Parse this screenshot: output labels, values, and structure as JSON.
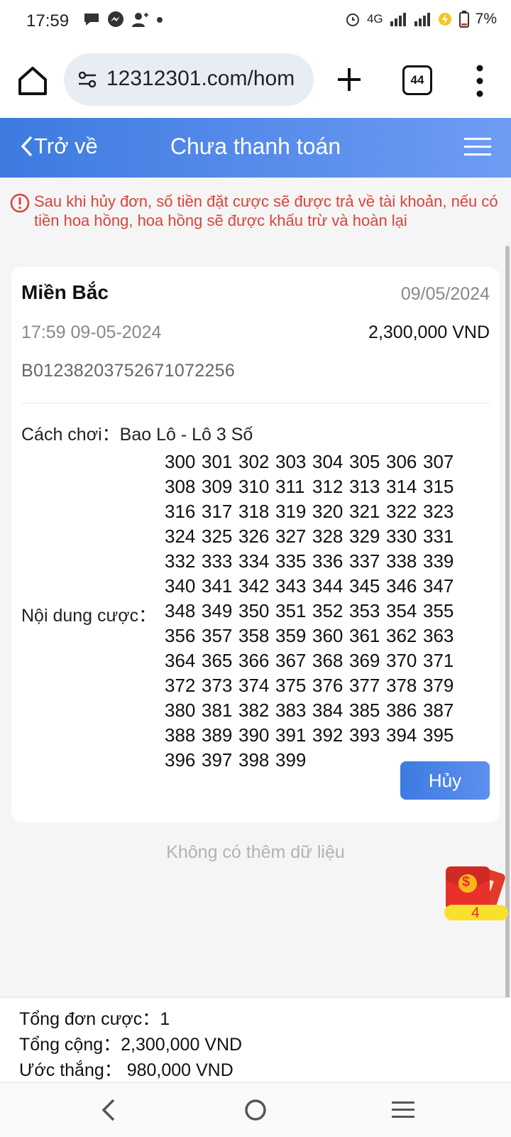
{
  "status": {
    "time": "17:59",
    "network": "4G",
    "battery": "7%"
  },
  "browser": {
    "url": "12312301.com/hom",
    "tab_count": "44"
  },
  "header": {
    "back_label": "Trở về",
    "title": "Chưa thanh toán"
  },
  "notice": {
    "text": "Sau khi hủy đơn, số tiền đặt cược sẽ được trả về tài khoản, nếu có tiền hoa hồng, hoa hồng sẽ được khấu trừ và hoàn lại"
  },
  "order": {
    "region": "Miền Bắc",
    "date": "09/05/2024",
    "time": "17:59 09-05-2024",
    "amount": "2,300,000 VND",
    "code": "B01238203752671072256",
    "play_type_label": "Cách chơi：",
    "play_type": "Bao Lô - Lô 3 Số",
    "bet_label": "Nội dung cược：",
    "numbers": [
      [
        "300",
        "301",
        "302",
        "303",
        "304",
        "305",
        "306",
        "307"
      ],
      [
        "308",
        "309",
        "310",
        "311",
        "312",
        "313",
        "314",
        "315"
      ],
      [
        "316",
        "317",
        "318",
        "319",
        "320",
        "321",
        "322",
        "323"
      ],
      [
        "324",
        "325",
        "326",
        "327",
        "328",
        "329",
        "330",
        "331"
      ],
      [
        "332",
        "333",
        "334",
        "335",
        "336",
        "337",
        "338",
        "339"
      ],
      [
        "340",
        "341",
        "342",
        "343",
        "344",
        "345",
        "346",
        "347"
      ],
      [
        "348",
        "349",
        "350",
        "351",
        "352",
        "353",
        "354",
        "355"
      ],
      [
        "356",
        "357",
        "358",
        "359",
        "360",
        "361",
        "362",
        "363"
      ],
      [
        "364",
        "365",
        "366",
        "367",
        "368",
        "369",
        "370",
        "371"
      ],
      [
        "372",
        "373",
        "374",
        "375",
        "376",
        "377",
        "378",
        "379"
      ],
      [
        "380",
        "381",
        "382",
        "383",
        "384",
        "385",
        "386",
        "387"
      ],
      [
        "388",
        "389",
        "390",
        "391",
        "392",
        "393",
        "394",
        "395"
      ],
      [
        "396",
        "397",
        "398",
        "399"
      ]
    ],
    "cancel_label": "Hủy"
  },
  "no_more": "Không có thêm dữ liệu",
  "red_envelope": {
    "count": "4",
    "symbol": "$"
  },
  "summary": {
    "total_orders": "Tổng đơn cược：1",
    "total": "Tổng cộng：2,300,000 VND",
    "estimated_win": "Ước thắng：  980,000 VND"
  },
  "colors": {
    "accent": "#3d7be0",
    "warning": "#d9433b"
  }
}
